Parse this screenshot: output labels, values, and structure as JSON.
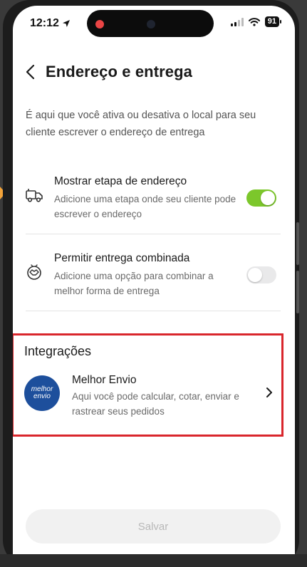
{
  "status_bar": {
    "time": "12:12",
    "battery": "91"
  },
  "header": {
    "title": "Endereço e entrega"
  },
  "intro": "É aqui que você ativa ou desativa o local para seu cliente escrever o endereço de entrega",
  "options": [
    {
      "title": "Mostrar etapa de endereço",
      "description": "Adicione uma etapa onde seu cliente pode escrever o endereço",
      "enabled": true,
      "icon": "delivery-truck-icon"
    },
    {
      "title": "Permitir entrega combinada",
      "description": "Adicione uma opção para combinar a melhor forma de entrega",
      "enabled": false,
      "icon": "handshake-icon"
    }
  ],
  "integrations": {
    "title": "Integrações",
    "items": [
      {
        "name": "Melhor Envio",
        "description": "Aqui você pode calcular, cotar, enviar e rastrear seus pedidos",
        "logo_text": "melhor envio"
      }
    ]
  },
  "save_label": "Salvar",
  "colors": {
    "toggle_on": "#7cc72b",
    "highlight": "#d9262c",
    "logo_bg": "#1d4f9c"
  }
}
